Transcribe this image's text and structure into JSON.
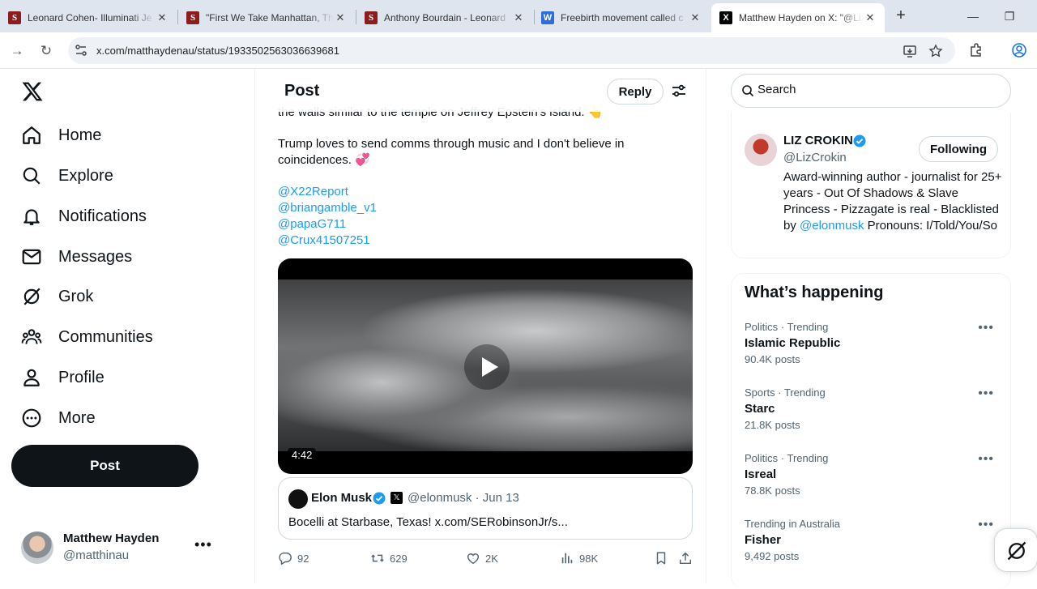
{
  "browser": {
    "tabs": [
      {
        "title": "Leonard Cohen- Illuminati Je",
        "favicon": "S"
      },
      {
        "title": "\"First We Take Manhattan, Th",
        "favicon": "S"
      },
      {
        "title": "Anthony Bourdain - Leonard",
        "favicon": "S"
      },
      {
        "title": "Freebirth movement called c",
        "favicon": "W"
      },
      {
        "title": "Matthew Hayden on X: \"@Liz",
        "favicon": "X"
      }
    ],
    "url": "x.com/matthaydenau/status/1933502563036639681"
  },
  "nav": {
    "items": [
      "Home",
      "Explore",
      "Notifications",
      "Messages",
      "Grok",
      "Communities",
      "Profile",
      "More"
    ],
    "post_label": "Post",
    "user": {
      "name": "Matthew Hayden",
      "handle": "@matthinau"
    }
  },
  "header": {
    "title": "Post",
    "reply_label": "Reply"
  },
  "post": {
    "cut_text": "the walls similar to the temple on Jeffrey Epstein's island. 👆",
    "text": "Trump loves to send comms through music and I don't believe in coincidences. 💞",
    "mentions": [
      "@X22Report",
      "@briangamble_v1",
      "@papaG711",
      "@Crux41507251"
    ],
    "video_duration": "4:42",
    "quote": {
      "name": "Elon Musk",
      "handle": "@elonmusk · Jun 13",
      "text": "Bocelli at Starbase, Texas! x.com/SERobinsonJr/s..."
    },
    "stats": {
      "replies": "92",
      "reposts": "629",
      "likes": "2K",
      "views": "98K"
    }
  },
  "sidebar": {
    "search_placeholder": "Search",
    "profile": {
      "name": "LIZ CROKIN",
      "handle": "@LizCrokin",
      "follow_label": "Following",
      "bio_pre": "Award-winning author - journalist for 25+ years - Out Of Shadows & Slave Princess - Pizzagate is real - Blacklisted by ",
      "bio_link": "@elonmusk",
      "bio_post": " Pronouns: I/Told/You/So"
    },
    "trends_title": "What’s happening",
    "trends": [
      {
        "context": "Politics · Trending",
        "name": "Islamic Republic",
        "posts": "90.4K posts"
      },
      {
        "context": "Sports · Trending",
        "name": "Starc",
        "posts": "21.8K posts"
      },
      {
        "context": "Politics · Trending",
        "name": "Isreal",
        "posts": "78.8K posts"
      },
      {
        "context": "Trending in Australia",
        "name": "Fisher",
        "posts": "9,492 posts"
      }
    ]
  },
  "colors": {
    "accent": "#1d9bf0",
    "text": "#0f1419",
    "muted": "#536471"
  }
}
